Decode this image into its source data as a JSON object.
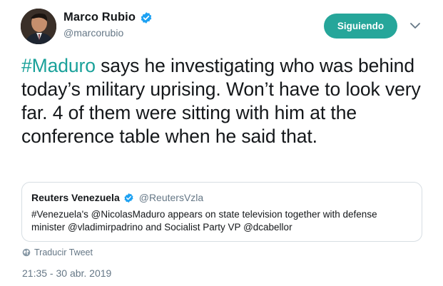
{
  "author": {
    "display_name": "Marco Rubio",
    "handle": "@marcorubio"
  },
  "follow_button": {
    "label": "Siguiendo"
  },
  "tweet": {
    "hashtag": "#Maduro",
    "text": " says he investigating who was behind today’s military uprising. Won’t have to look very far. 4 of them were sitting with him at the conference table when he said that."
  },
  "quoted_tweet": {
    "display_name": "Reuters Venezuela",
    "handle": "@ReutersVzla",
    "text": "#Venezuela's @NicolasMaduro appears on state television together with defense minister @vladimirpadrino and Socialist Party VP @dcabellor"
  },
  "translate": {
    "label": "Traducir Tweet"
  },
  "timestamp": "21:35 - 30 abr. 2019",
  "colors": {
    "accent": "#1aa19a",
    "follow_button_bg": "#26a69a",
    "verified_badge": "#1da1f2",
    "secondary_text": "#657786"
  },
  "icons": {
    "verified": "verified-badge-icon",
    "caret": "chevron-down-icon",
    "globe": "globe-icon"
  }
}
